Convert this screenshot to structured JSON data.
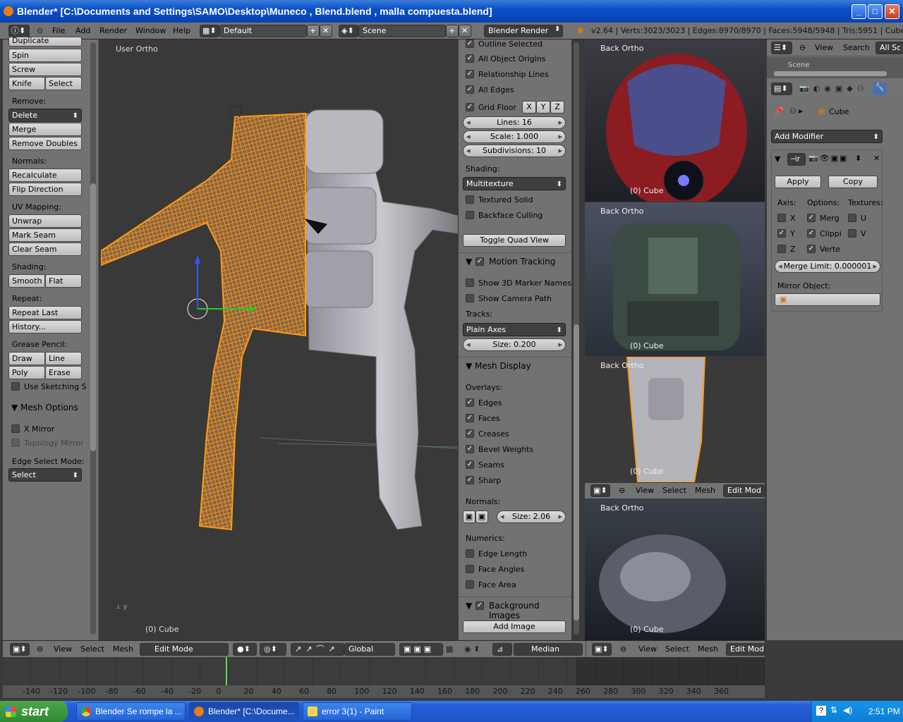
{
  "window": {
    "title": "Blender* [C:\\Documents and Settings\\SAMO\\Desktop\\Muneco , Blend.blend , malla compuesta.blend]"
  },
  "topbar": {
    "menus": [
      "File",
      "Add",
      "Render",
      "Window",
      "Help"
    ],
    "layout": "Default",
    "scene": "Scene",
    "engine": "Blender Render",
    "stats": "v2.64 | Verts:3023/3023 | Edges:8970/8970 | Faces:5948/5948 | Tris:5951 | Cube"
  },
  "toolshelf": {
    "b_duplicate": "Duplicate",
    "b_spin": "Spin",
    "b_screw": "Screw",
    "b_knife": "Knife",
    "b_select": "Select",
    "remove": "Remove:",
    "delete": "Delete",
    "merge": "Merge",
    "remove_doubles": "Remove Doubles",
    "normals": "Normals:",
    "recalculate": "Recalculate",
    "flip": "Flip Direction",
    "uv": "UV Mapping:",
    "unwrap": "Unwrap",
    "mark_seam": "Mark Seam",
    "clear_seam": "Clear Seam",
    "shading": "Shading:",
    "smooth": "Smooth",
    "flat": "Flat",
    "repeat": "Repeat:",
    "repeat_last": "Repeat Last",
    "history": "History...",
    "grease": "Grease Pencil:",
    "draw": "Draw",
    "line": "Line",
    "poly": "Poly",
    "erase": "Erase",
    "use_sketching": "Use Sketching S",
    "mesh_options": "Mesh Options",
    "x_mirror": "X Mirror",
    "topology_mirror": "Topology Mirror",
    "edge_select_mode": "Edge Select Mode:",
    "select_mode": "Select"
  },
  "viewport": {
    "label": "User Ortho",
    "object": "(0) Cube"
  },
  "npanel": {
    "outline_selected": "Outline Selected",
    "all_object_origins": "All Object Origins",
    "relationship_lines": "Relationship Lines",
    "all_edges": "All Edges",
    "grid_floor": "Grid Floor",
    "gx": "X",
    "gy": "Y",
    "gz": "Z",
    "lines": "Lines: 16",
    "scale": "Scale: 1.000",
    "subdivisions": "Subdivisions: 10",
    "shading": "Shading:",
    "multitexture": "Multitexture",
    "textured_solid": "Textured Solid",
    "backface_culling": "Backface Culling",
    "toggle_quad": "Toggle Quad View",
    "motion_tracking": "Motion Tracking",
    "show_3d_marker": "Show 3D Marker Names",
    "show_camera_path": "Show Camera Path",
    "tracks": "Tracks:",
    "plain_axes": "Plain Axes",
    "track_size": "Size: 0.200",
    "mesh_display": "Mesh Display",
    "overlays": "Overlays:",
    "edges": "Edges",
    "faces": "Faces",
    "creases": "Creases",
    "bevel_weights": "Bevel Weights",
    "seams": "Seams",
    "sharp": "Sharp",
    "normals": "Normals:",
    "normal_size": "Size: 2.06",
    "numerics": "Numerics:",
    "edge_length": "Edge Length",
    "face_angles": "Face Angles",
    "face_area": "Face Area",
    "background_images": "Background Images",
    "add_image": "Add Image"
  },
  "sideviews": {
    "label": "Back Ortho",
    "object": "(0) Cube",
    "header": {
      "view": "View",
      "select": "Select",
      "mesh": "Mesh",
      "mode": "Edit Mod"
    }
  },
  "props": {
    "view": "View",
    "search": "Search",
    "all_scenes": "All Sc",
    "scene_item": "Scene",
    "object": "Cube",
    "add_modifier": "Add Modifier",
    "apply": "Apply",
    "copy": "Copy",
    "axis": "Axis:",
    "options": "Options:",
    "textures": "Textures:",
    "x": "X",
    "y": "Y",
    "z": "Z",
    "merg": "Merg",
    "clippi": "Clippi",
    "verte": "Verte",
    "u": "U",
    "v": "V",
    "merge_limit": "Merge Limit: 0.000001",
    "mirror_object": "Mirror Object:"
  },
  "bottombar": {
    "view": "View",
    "select": "Select",
    "mesh": "Mesh",
    "mode": "Edit Mode",
    "orientation": "Global",
    "pivot": "Median"
  },
  "timeline": {
    "ticks": [
      "-140",
      "-120",
      "-100",
      "-80",
      "-60",
      "-40",
      "-20",
      "0",
      "20",
      "40",
      "60",
      "80",
      "100",
      "120",
      "140",
      "160",
      "180",
      "200",
      "220",
      "240",
      "260",
      "280",
      "300",
      "320",
      "340",
      "360"
    ],
    "current_frame": 0
  },
  "taskbar": {
    "start": "start",
    "tasks": [
      "Blender Se rompe la ...",
      "Blender* [C:\\Docume...",
      "error 3(1) - Paint"
    ],
    "clock": "2:51 PM"
  }
}
